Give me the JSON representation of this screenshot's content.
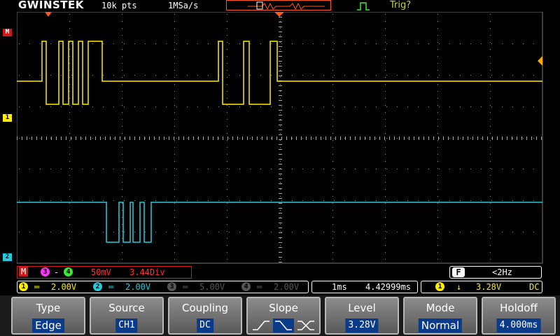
{
  "topbar": {
    "brand": "GWINSTEK",
    "record_length": "10k pts",
    "sample_rate": "1MSa/s",
    "trigger_status": "Trig?"
  },
  "colors": {
    "ch1": "#ffee00",
    "ch2": "#22ccdd",
    "math": "#d01818",
    "ch3": "#ff33ff",
    "ch4": "#33ee33"
  },
  "markers": {
    "math": "M",
    "ch1": "1",
    "ch2": "2"
  },
  "math_status": {
    "label": "M",
    "ch_a": "3",
    "op": "-",
    "ch_b": "4",
    "scale": "50mV",
    "offset": "3.44Div"
  },
  "freq_status": {
    "icon": "F",
    "value": "<2Hz"
  },
  "channels": [
    {
      "num": "1",
      "scale": "2.00V"
    },
    {
      "num": "2",
      "scale": "2.00V"
    },
    {
      "num": "3",
      "scale": "5.00V"
    },
    {
      "num": "4",
      "scale": "2.00V"
    }
  ],
  "timebase": {
    "scale": "1ms",
    "position": "4.42999ms"
  },
  "trigger_info": {
    "source": "1",
    "level": "3.28V",
    "coupling": "DC"
  },
  "softkeys": [
    {
      "label": "Type",
      "value": "Edge"
    },
    {
      "label": "Source",
      "value": "CH1"
    },
    {
      "label": "Coupling",
      "value": "DC"
    },
    {
      "label": "Slope",
      "value": ""
    },
    {
      "label": "Level",
      "value": "3.28V"
    },
    {
      "label": "Mode",
      "value": "Normal"
    },
    {
      "label": "Holdoff",
      "value": "4.000ms"
    }
  ],
  "waveforms": {
    "ch1_segments": [
      [
        0,
        56
      ],
      [
        84,
        90
      ],
      [
        98,
        104
      ],
      [
        112,
        118
      ],
      [
        126,
        144
      ],
      [
        310,
        318
      ],
      [
        345,
        354
      ],
      [
        382,
        392
      ]
    ],
    "ch2_segments": [
      [
        128,
        152
      ],
      [
        156,
        172
      ],
      [
        176,
        186
      ],
      [
        192,
        200
      ]
    ]
  }
}
